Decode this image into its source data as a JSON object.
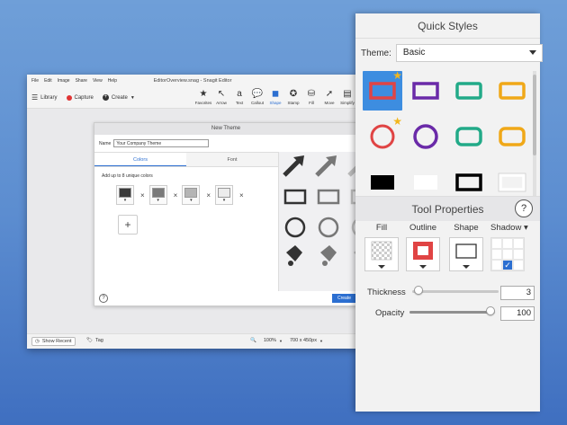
{
  "editor": {
    "menu": [
      "File",
      "Edit",
      "Image",
      "Share",
      "View",
      "Help"
    ],
    "title": "EditorOverview.snag - Snagit Editor",
    "library_label": "Library",
    "capture_label": "Capture",
    "create_label": "Create",
    "tools": [
      {
        "label": "Favorites",
        "icon": "star-icon",
        "glyph": "★"
      },
      {
        "label": "Arrow",
        "icon": "arrow-icon",
        "glyph": "↖"
      },
      {
        "label": "Text",
        "icon": "text-icon",
        "glyph": "a"
      },
      {
        "label": "Callout",
        "icon": "callout-icon",
        "glyph": "💬"
      },
      {
        "label": "Shape",
        "icon": "shape-icon",
        "glyph": "◼"
      },
      {
        "label": "Stamp",
        "icon": "stamp-icon",
        "glyph": "✪"
      },
      {
        "label": "Fill",
        "icon": "fill-icon",
        "glyph": "⛁"
      },
      {
        "label": "Move",
        "icon": "move-icon",
        "glyph": "➚"
      },
      {
        "label": "Simplify",
        "icon": "simplify-icon",
        "glyph": "▤"
      }
    ],
    "status": {
      "show_recent": "Show Recent",
      "tag": "Tag",
      "zoom": "100%",
      "size": "700 x 450px"
    }
  },
  "new_theme": {
    "title": "New Theme",
    "name_label": "Name",
    "name_value": "Your Company Theme",
    "tabs": [
      "Colors",
      "Font"
    ],
    "active_tab": "Colors",
    "add_colors_label": "Add up to 8 unique colors",
    "swatch_colors": [
      "#3a3a3a",
      "#7a7a7a",
      "#b5b5b5",
      "#ececec"
    ],
    "add_symbol": "+",
    "help": "?",
    "create_label": "Create"
  },
  "quick_styles": {
    "title": "Quick Styles",
    "theme_label": "Theme:",
    "theme_value": "Basic"
  },
  "tool_properties": {
    "title": "Tool Properties",
    "help": "?",
    "fill_label": "Fill",
    "outline_label": "Outline",
    "shape_label": "Shape",
    "shadow_label": "Shadow",
    "shadow_arrow": "▾",
    "thickness_label": "Thickness",
    "thickness_value": "3",
    "thickness_fraction": 0.02,
    "opacity_label": "Opacity",
    "opacity_value": "100",
    "opacity_fraction": 1.0,
    "outline_color": "#e04444"
  },
  "colors": {
    "accent": "#2c6fd1",
    "selected": "#3d8de0",
    "red": "#e04444",
    "purple": "#6a2aa8",
    "teal": "#22aa88",
    "orange": "#f0a818"
  }
}
